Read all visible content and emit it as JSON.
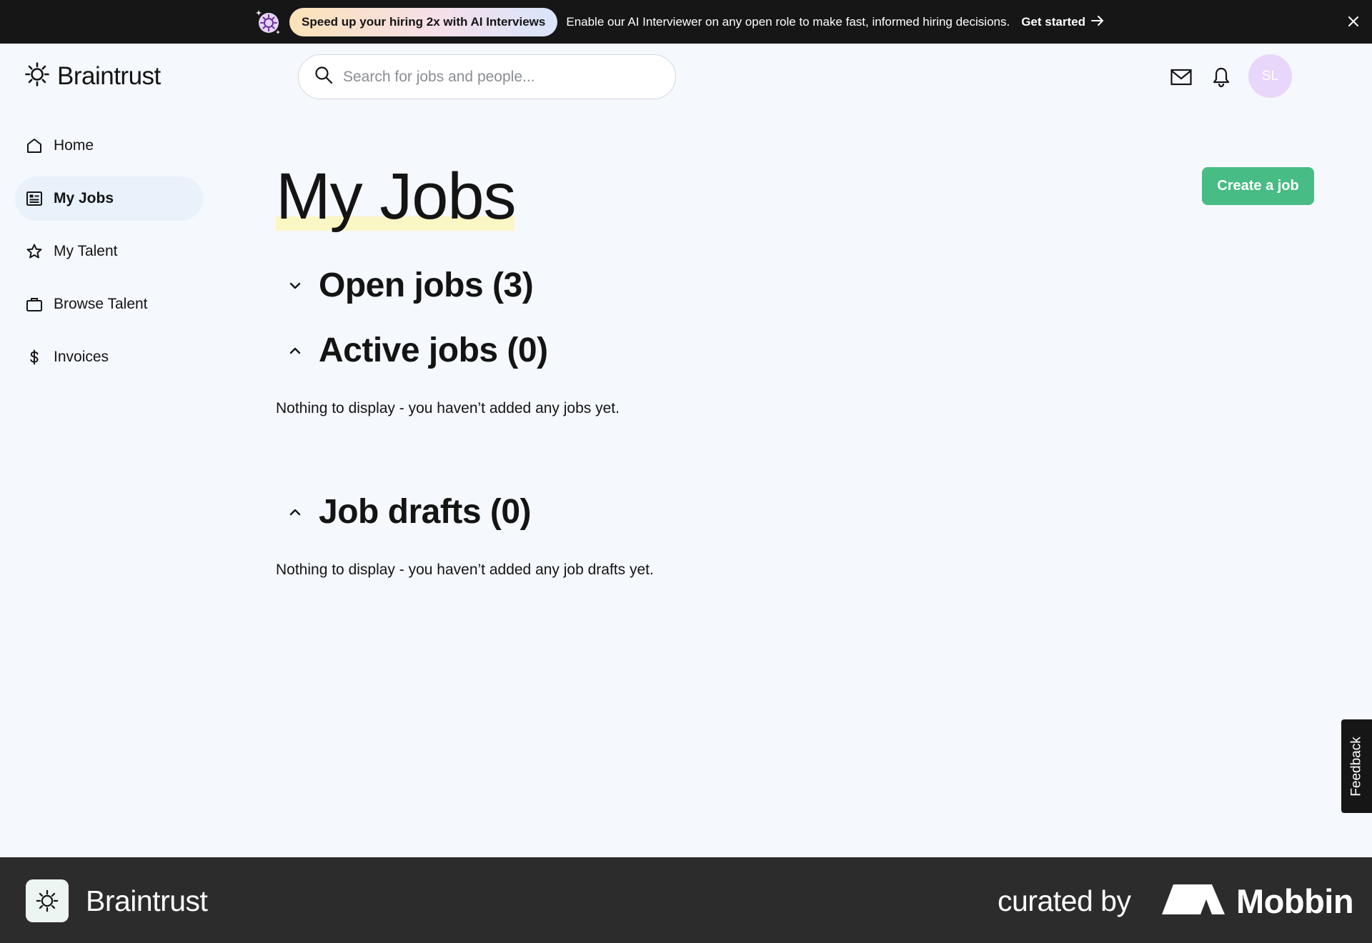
{
  "banner": {
    "pill": "Speed up your hiring 2x with AI Interviews",
    "text": "Enable our AI Interviewer on any open role to make fast, informed hiring decisions.",
    "cta": "Get started",
    "icon": "sparkle-gear-icon",
    "close_icon": "close-icon"
  },
  "header": {
    "logo": "Braintrust",
    "search_placeholder": "Search for jobs and people...",
    "avatar_initials": "SL"
  },
  "sidebar": {
    "items": [
      {
        "label": "Home",
        "icon": "home-icon",
        "active": false
      },
      {
        "label": "My Jobs",
        "icon": "jobs-card-icon",
        "active": true
      },
      {
        "label": "My Talent",
        "icon": "star-icon",
        "active": false
      },
      {
        "label": "Browse Talent",
        "icon": "briefcase-icon",
        "active": false
      },
      {
        "label": "Invoices",
        "icon": "dollar-icon",
        "active": false
      }
    ]
  },
  "main": {
    "title": "My Jobs",
    "create_button": "Create a job",
    "sections": [
      {
        "title": "Open jobs (3)",
        "expanded": false,
        "empty": ""
      },
      {
        "title": "Active jobs (0)",
        "expanded": true,
        "empty": "Nothing to display - you haven’t added any jobs yet."
      },
      {
        "title": "Job drafts (0)",
        "expanded": true,
        "empty": "Nothing to display - you haven’t added any job drafts yet."
      }
    ]
  },
  "feedback": "Feedback",
  "footer": {
    "brand": "Braintrust",
    "curated": "curated by",
    "mobbin": "Mobbin"
  },
  "colors": {
    "accent_green": "#47bc84",
    "nav_active_bg": "#e9f1fb",
    "avatar_bg": "#e9d6fb",
    "title_highlight": "#fbf7c4"
  }
}
